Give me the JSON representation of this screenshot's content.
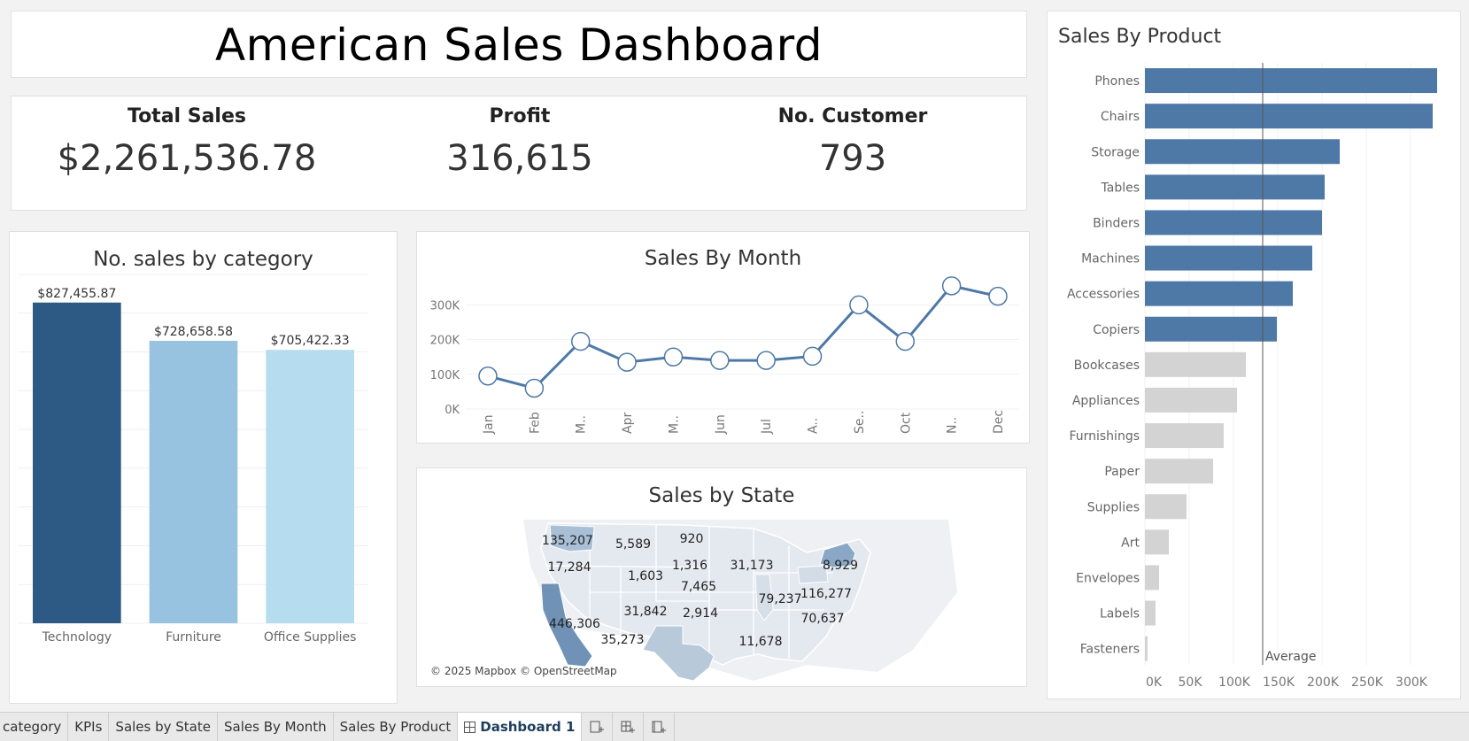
{
  "dashboard": {
    "title": "American Sales Dashboard"
  },
  "kpis": [
    {
      "label": "Total Sales",
      "value": "$2,261,536.78"
    },
    {
      "label": "Profit",
      "value": "316,615"
    },
    {
      "label": "No. Customer",
      "value": "793"
    }
  ],
  "category_chart": {
    "title": "No. sales by category",
    "chart_data": {
      "type": "bar",
      "categories": [
        "Technology",
        "Furniture",
        "Office Supplies"
      ],
      "values": [
        827455.87,
        728658.58,
        705422.33
      ],
      "labels": [
        "$827,455.87",
        "$728,658.58",
        "$705,422.33"
      ],
      "colors": [
        "#2c5a84",
        "#97c3e0",
        "#b6dcef"
      ],
      "ylim": [
        0,
        900000
      ],
      "grid": true
    }
  },
  "month_chart": {
    "title": "Sales By Month",
    "chart_data": {
      "type": "line",
      "categories": [
        "Jan",
        "Feb",
        "M..",
        "Apr",
        "M..",
        "Jun",
        "Jul",
        "A..",
        "Se..",
        "Oct",
        "N..",
        "Dec"
      ],
      "values": [
        95000,
        60000,
        195000,
        135000,
        150000,
        140000,
        140000,
        152000,
        300000,
        195000,
        355000,
        325000
      ],
      "yticks": [
        "0K",
        "100K",
        "200K",
        "300K"
      ],
      "ylim": [
        0,
        370000
      ],
      "color": "#4e79a7"
    }
  },
  "state_map": {
    "title": "Sales by State",
    "labels": [
      "135,207",
      "5,589",
      "920",
      "17,284",
      "1,603",
      "1,316",
      "31,173",
      "8,929",
      "7,465",
      "79,237",
      "116,277",
      "31,842",
      "2,914",
      "70,637",
      "446,306",
      "35,273",
      "11,678"
    ],
    "copyright": "© 2025 Mapbox © OpenStreetMap"
  },
  "product_chart": {
    "title": "Sales By Product",
    "average_label": "Average",
    "chart_data": {
      "type": "bar",
      "orientation": "horizontal",
      "categories": [
        "Phones",
        "Chairs",
        "Storage",
        "Tables",
        "Binders",
        "Machines",
        "Accessories",
        "Copiers",
        "Bookcases",
        "Appliances",
        "Furnishings",
        "Paper",
        "Supplies",
        "Art",
        "Envelopes",
        "Labels",
        "Fasteners"
      ],
      "values": [
        330000,
        325000,
        220000,
        203000,
        200000,
        189000,
        167000,
        149000,
        114000,
        104000,
        89000,
        77000,
        47000,
        27000,
        16000,
        12000,
        3000
      ],
      "above_average_color": "#4e79a7",
      "below_average_color": "#d3d3d3",
      "average": 133000,
      "xticks": [
        "0K",
        "50K",
        "100K",
        "150K",
        "200K",
        "250K",
        "300K"
      ],
      "xlim": [
        0,
        300000
      ]
    }
  },
  "tabs": [
    {
      "label": "category"
    },
    {
      "label": "KPIs"
    },
    {
      "label": "Sales by State"
    },
    {
      "label": "Sales By Month"
    },
    {
      "label": "Sales By Product"
    },
    {
      "label": "Dashboard 1",
      "active": true
    }
  ],
  "tab_icons": [
    "new-worksheet-icon",
    "new-dashboard-icon",
    "new-story-icon"
  ]
}
